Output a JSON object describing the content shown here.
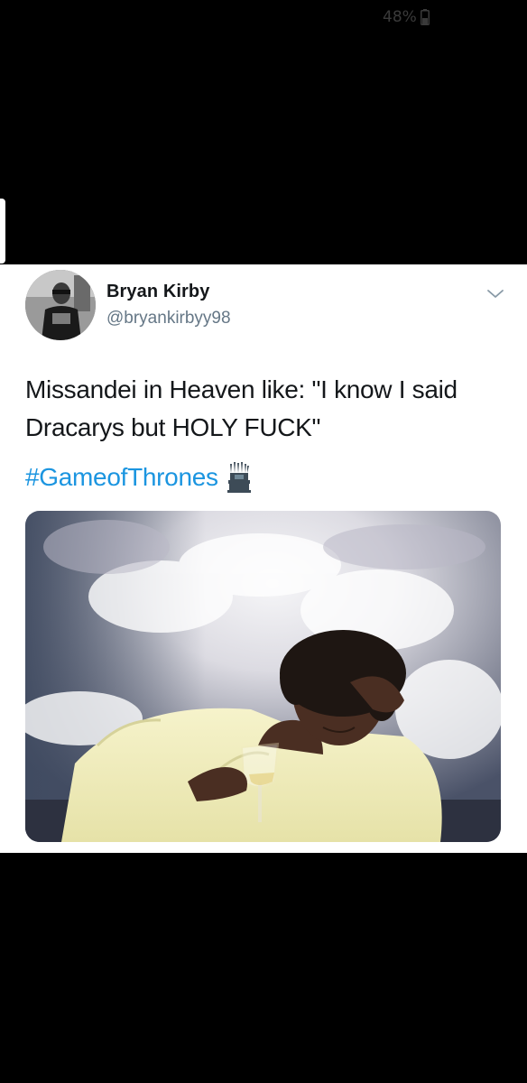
{
  "status_bar": {
    "battery_percent": "48%",
    "battery_icon": "battery-icon",
    "battery_level": 0.48
  },
  "tweet": {
    "author_name": "Bryan Kirby",
    "author_handle": "@bryankirbyy98",
    "avatar_icon": "avatar",
    "menu_icon": "chevron-down-icon",
    "text": "Missandei in Heaven like: \"I know I said Dracarys but HOLY FUCK\"",
    "hashtag": "#GameofThrones",
    "hashtag_emoji_icon": "iron-throne-icon",
    "media_description": "woman-in-clouds-with-wine-glass"
  },
  "colors": {
    "background": "#000000",
    "card": "#ffffff",
    "text_primary": "#14171a",
    "text_secondary": "#657786",
    "link": "#1b95e0"
  }
}
